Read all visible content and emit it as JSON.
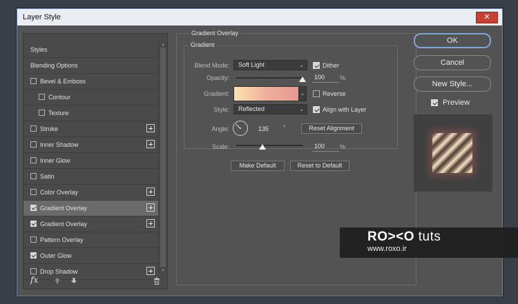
{
  "dialog": {
    "title": "Layer Style",
    "close_glyph": "✕"
  },
  "styles_panel": {
    "items": [
      {
        "label": "Styles",
        "checkbox": false,
        "checked": false,
        "add": false
      },
      {
        "label": "Blending Options",
        "checkbox": false,
        "checked": false,
        "add": false
      },
      {
        "label": "Bevel & Emboss",
        "checkbox": true,
        "checked": false,
        "add": false
      },
      {
        "label": "Contour",
        "checkbox": true,
        "checked": false,
        "add": false,
        "indent": true
      },
      {
        "label": "Texture",
        "checkbox": true,
        "checked": false,
        "add": false,
        "indent": true
      },
      {
        "label": "Stroke",
        "checkbox": true,
        "checked": false,
        "add": true
      },
      {
        "label": "Inner Shadow",
        "checkbox": true,
        "checked": false,
        "add": true
      },
      {
        "label": "Inner Glow",
        "checkbox": true,
        "checked": false,
        "add": false
      },
      {
        "label": "Satin",
        "checkbox": true,
        "checked": false,
        "add": false
      },
      {
        "label": "Color Overlay",
        "checkbox": true,
        "checked": false,
        "add": true
      },
      {
        "label": "Gradient Overlay",
        "checkbox": true,
        "checked": true,
        "add": true,
        "active": true
      },
      {
        "label": "Gradient Overlay",
        "checkbox": true,
        "checked": true,
        "add": true
      },
      {
        "label": "Pattern Overlay",
        "checkbox": true,
        "checked": false,
        "add": false
      },
      {
        "label": "Outer Glow",
        "checkbox": true,
        "checked": true,
        "add": false
      },
      {
        "label": "Drop Shadow",
        "checkbox": true,
        "checked": false,
        "add": true
      }
    ],
    "fx_label": "fx"
  },
  "gradient_overlay": {
    "section_title": "Gradient Overlay",
    "group_title": "Gradient",
    "blend_mode_label": "Blend Mode:",
    "blend_mode_value": "Soft Light",
    "dither_label": "Dither",
    "dither_checked": true,
    "opacity_label": "Opacity:",
    "opacity_value": "100",
    "opacity_fraction": 1.0,
    "percent_unit": "%",
    "gradient_label": "Gradient:",
    "gradient_colors": [
      "#fbe2b0",
      "#eeb09c",
      "#e8988f"
    ],
    "reverse_label": "Reverse",
    "reverse_checked": false,
    "style_label": "Style:",
    "style_value": "Reflected",
    "align_label": "Align with Layer",
    "align_checked": true,
    "angle_label": "Angle:",
    "angle_value": "135",
    "angle_degrees": 135,
    "degree_unit": "°",
    "reset_alignment_label": "Reset Alignment",
    "scale_label": "Scale:",
    "scale_value": "100",
    "scale_fraction": 0.4,
    "make_default_label": "Make Default",
    "reset_default_label": "Reset to Default"
  },
  "actions": {
    "ok_label": "OK",
    "cancel_label": "Cancel",
    "new_style_label": "New Style...",
    "preview_label": "Preview",
    "preview_checked": true
  },
  "watermark": {
    "logo_bold": "RO><O",
    "logo_thin": "tuts",
    "url": "www.roxo.ir"
  },
  "colors": {
    "dialog_bg": "#535353",
    "panel_bg": "#4a4a4a",
    "accent_border": "#7fa6d8",
    "close_red": "#c84031"
  }
}
